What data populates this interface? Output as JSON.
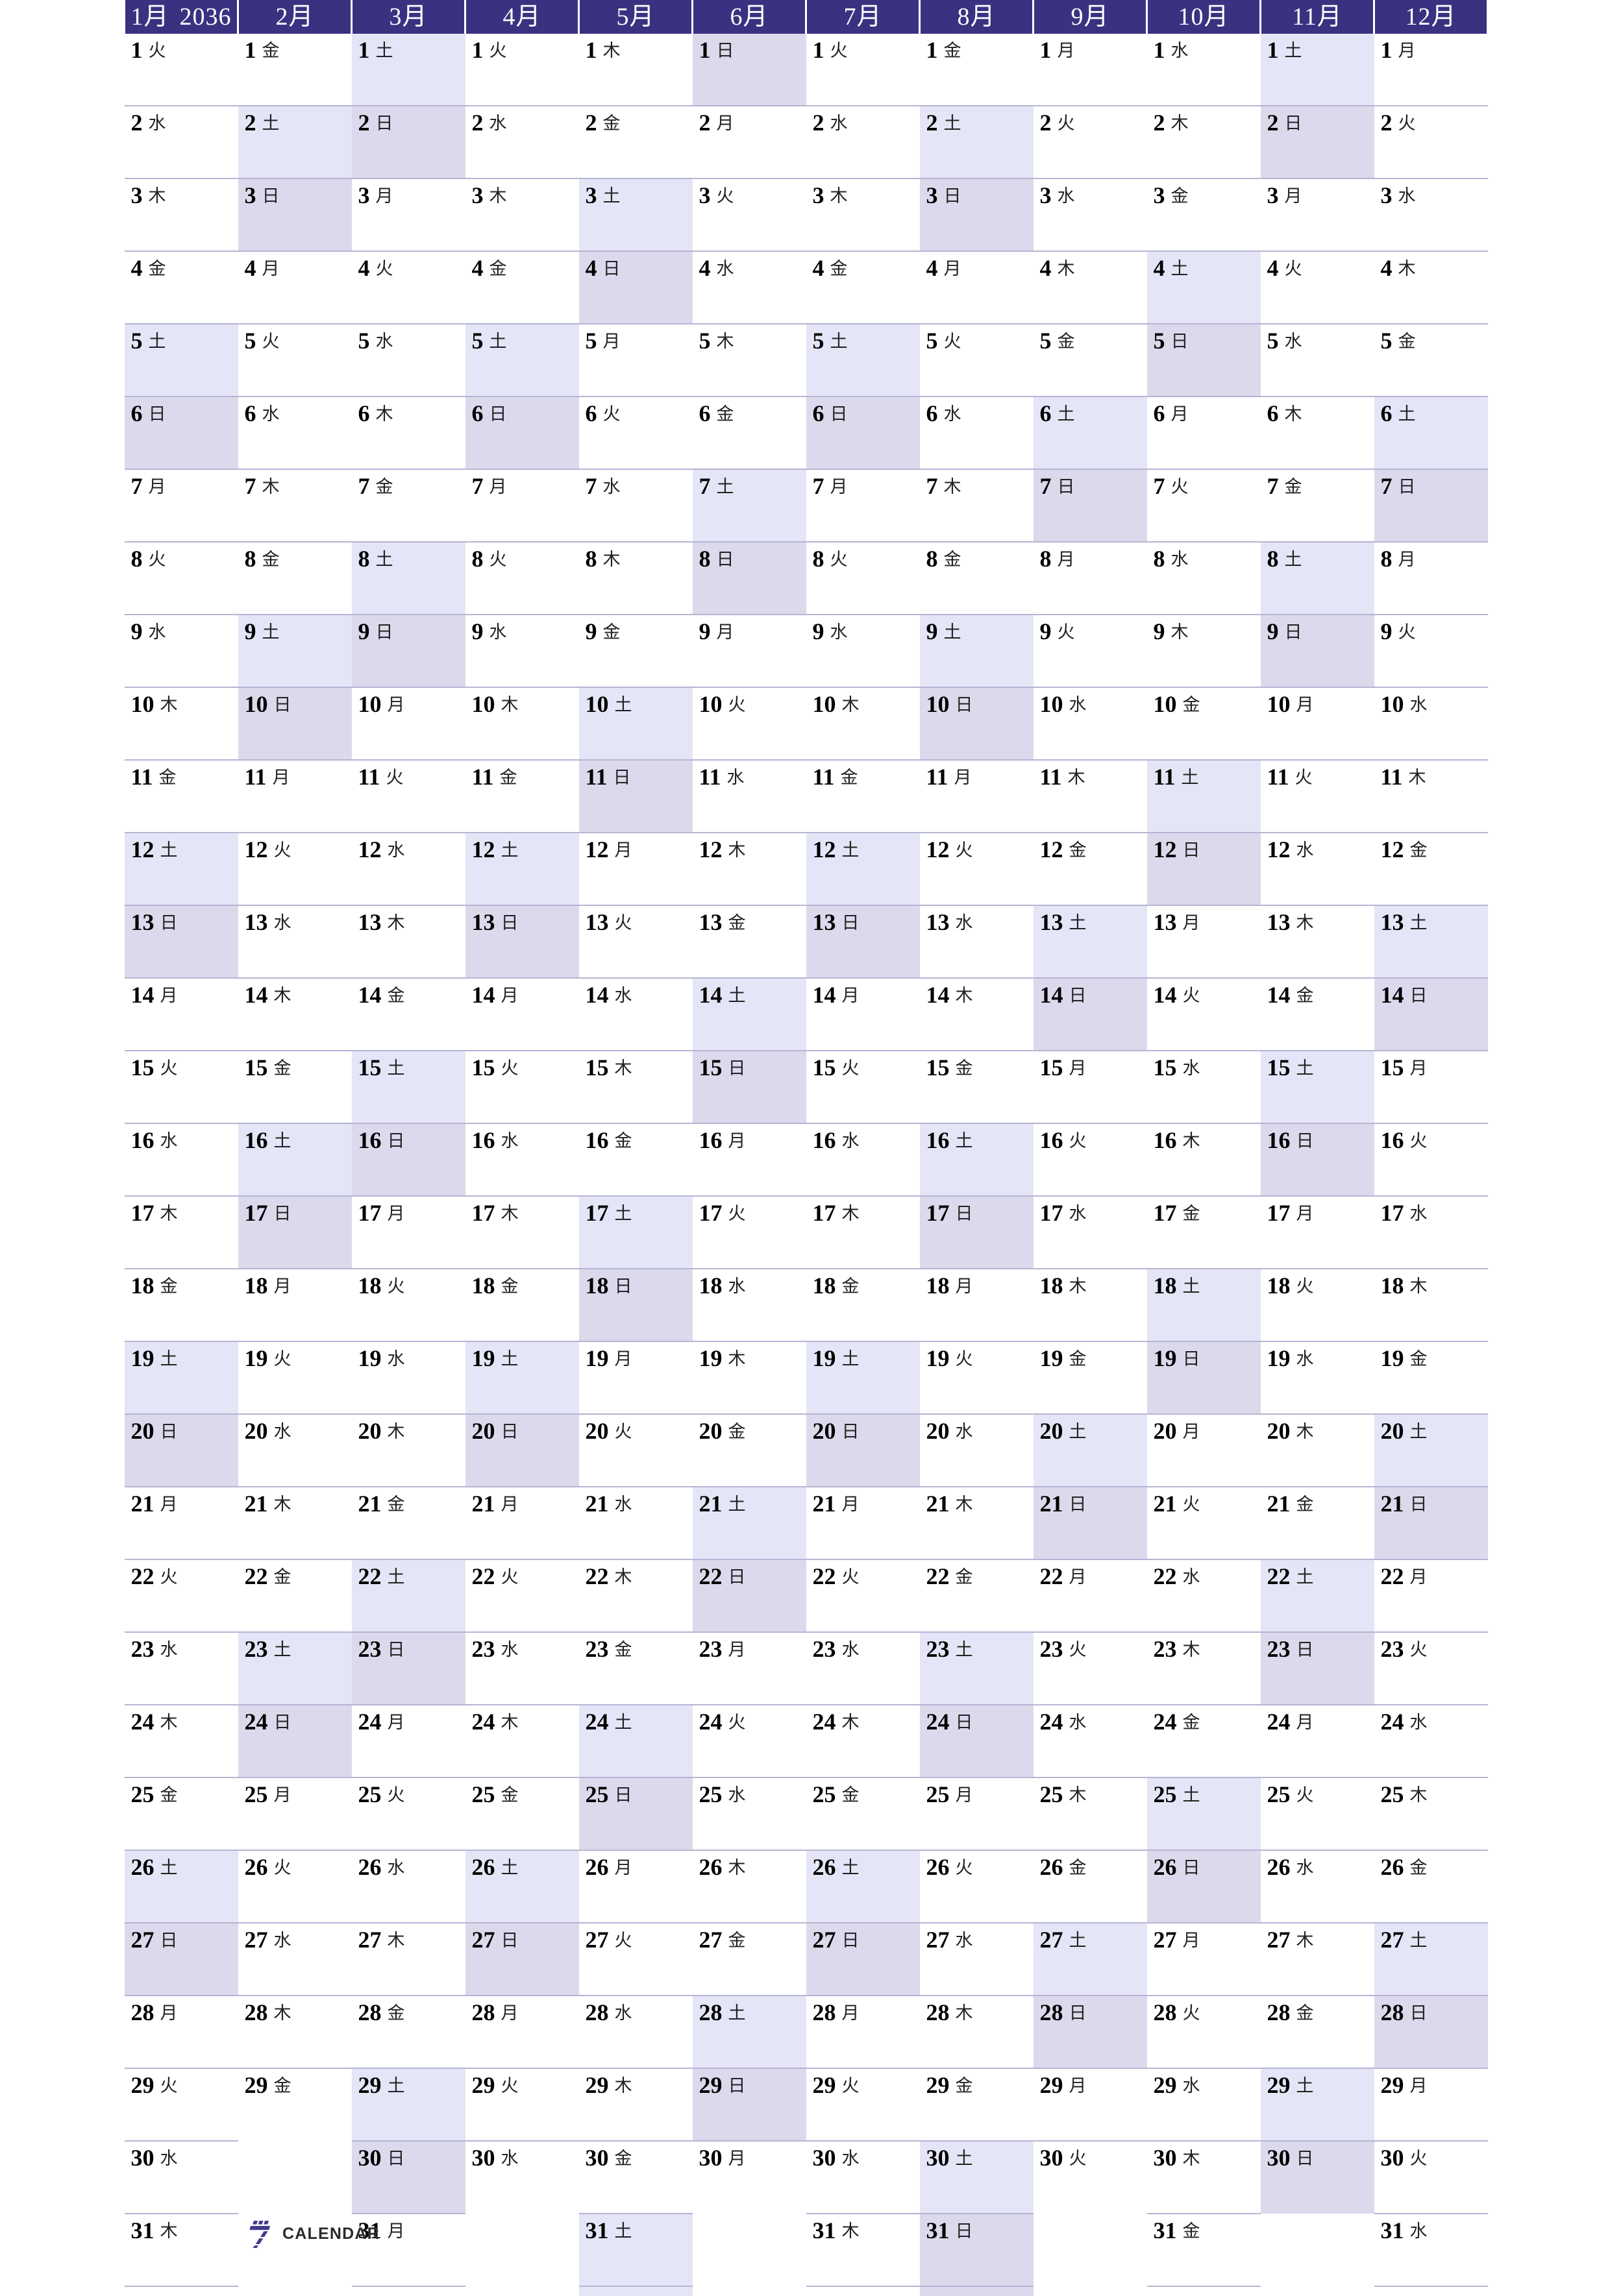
{
  "document": {
    "year": "2036",
    "year_label": "2036",
    "page_kind": "yearly-planner-vertical",
    "locale": "ja"
  },
  "logo": {
    "mark": "seven-icon",
    "text": "CALENDAR"
  },
  "colors": {
    "header_bg": "#3a3281",
    "header_text": "#ffffff",
    "saturday_bg": "#e4e5f6",
    "sunday_bg": "#dcd9ec",
    "grid_line": "#b7b4d4",
    "page_bg": "#ffffff",
    "day_number": "#000000",
    "logo_blue": "#3f3a8f"
  },
  "weekday_names": [
    "月",
    "火",
    "水",
    "木",
    "金",
    "土",
    "日"
  ],
  "row_count": 31,
  "months": [
    {
      "index": 1,
      "label": "1月",
      "year_suffix": "2036",
      "days": 31,
      "first_weekday": "火",
      "first_weekday_index": 1
    },
    {
      "index": 2,
      "label": "2月",
      "year_suffix": "",
      "days": 29,
      "first_weekday": "金",
      "first_weekday_index": 4
    },
    {
      "index": 3,
      "label": "3月",
      "year_suffix": "",
      "days": 31,
      "first_weekday": "土",
      "first_weekday_index": 5
    },
    {
      "index": 4,
      "label": "4月",
      "year_suffix": "",
      "days": 30,
      "first_weekday": "火",
      "first_weekday_index": 1
    },
    {
      "index": 5,
      "label": "5月",
      "year_suffix": "",
      "days": 31,
      "first_weekday": "木",
      "first_weekday_index": 3
    },
    {
      "index": 6,
      "label": "6月",
      "year_suffix": "",
      "days": 30,
      "first_weekday": "日",
      "first_weekday_index": 6
    },
    {
      "index": 7,
      "label": "7月",
      "year_suffix": "",
      "days": 31,
      "first_weekday": "火",
      "first_weekday_index": 1
    },
    {
      "index": 8,
      "label": "8月",
      "year_suffix": "",
      "days": 31,
      "first_weekday": "金",
      "first_weekday_index": 4
    },
    {
      "index": 9,
      "label": "9月",
      "year_suffix": "",
      "days": 30,
      "first_weekday": "月",
      "first_weekday_index": 0
    },
    {
      "index": 10,
      "label": "10月",
      "year_suffix": "",
      "days": 31,
      "first_weekday": "水",
      "first_weekday_index": 2
    },
    {
      "index": 11,
      "label": "11月",
      "year_suffix": "",
      "days": 30,
      "first_weekday": "土",
      "first_weekday_index": 5
    },
    {
      "index": 12,
      "label": "12月",
      "year_suffix": "",
      "days": 31,
      "first_weekday": "月",
      "first_weekday_index": 0
    }
  ]
}
